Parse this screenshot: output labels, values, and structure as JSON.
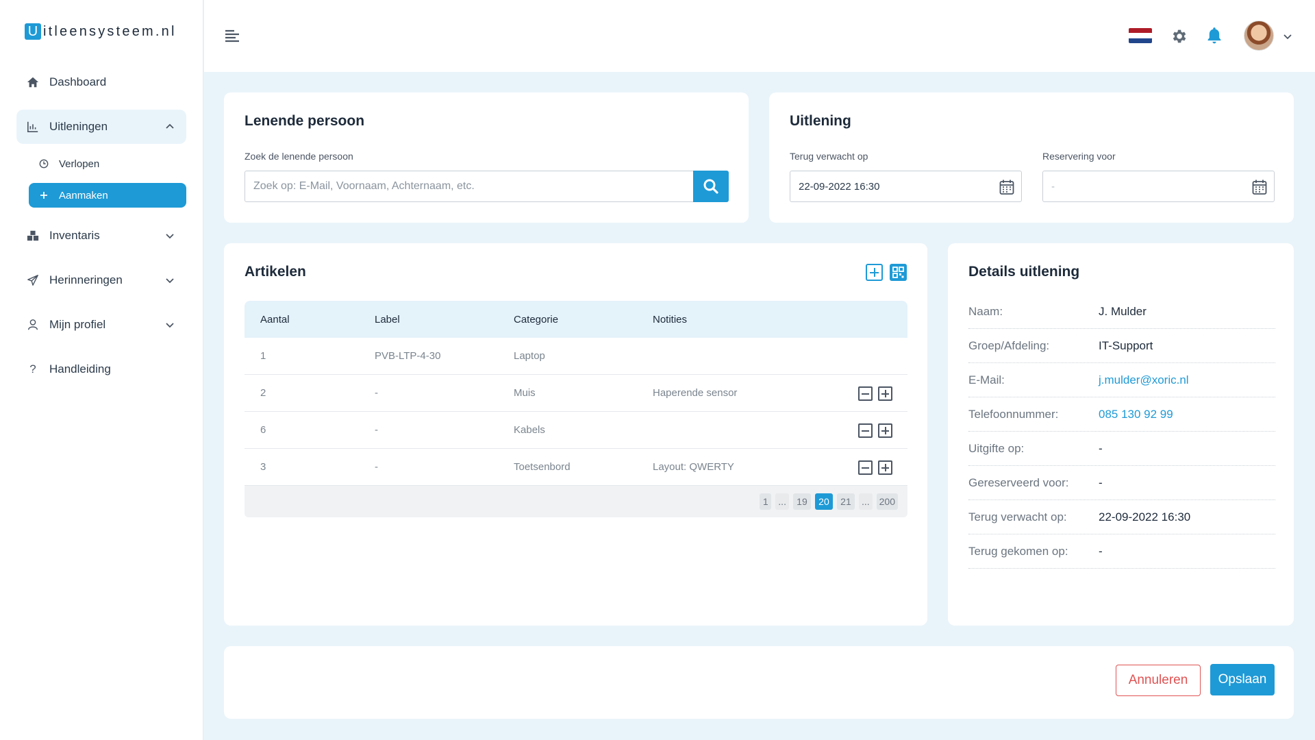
{
  "brand": {
    "initial": "U",
    "rest": "itleensysteem.nl"
  },
  "sidebar": {
    "items": [
      {
        "label": "Dashboard"
      },
      {
        "label": "Uitleningen"
      },
      {
        "label": "Inventaris"
      },
      {
        "label": "Herinneringen"
      },
      {
        "label": "Mijn profiel"
      },
      {
        "label": "Handleiding"
      }
    ],
    "subitems": [
      {
        "label": "Verlopen"
      },
      {
        "label": "Aanmaken"
      }
    ]
  },
  "borrower": {
    "title": "Lenende persoon",
    "search_label": "Zoek de lenende persoon",
    "search_placeholder": "Zoek op: E-Mail, Voornaam, Achternaam, etc."
  },
  "loan": {
    "title": "Uitlening",
    "return_label": "Terug verwacht op",
    "return_value": "22-09-2022 16:30",
    "reservation_label": "Reservering voor",
    "reservation_value": "-"
  },
  "articles": {
    "title": "Artikelen",
    "columns": [
      "Aantal",
      "Label",
      "Categorie",
      "Notities"
    ],
    "rows": [
      {
        "aantal": "1",
        "label": "PVB-LTP-4-30",
        "categorie": "Laptop",
        "notities": ""
      },
      {
        "aantal": "2",
        "label": "-",
        "categorie": "Muis",
        "notities": "Haperende sensor"
      },
      {
        "aantal": "6",
        "label": "-",
        "categorie": "Kabels",
        "notities": ""
      },
      {
        "aantal": "3",
        "label": "-",
        "categorie": "Toetsenbord",
        "notities": "Layout: QWERTY"
      }
    ],
    "pagination": [
      "1",
      "...",
      "19",
      "20",
      "21",
      "...",
      "200"
    ],
    "current_page": "20"
  },
  "details": {
    "title": "Details uitlening",
    "rows": [
      {
        "label": "Naam:",
        "value": "J. Mulder"
      },
      {
        "label": "Groep/Afdeling:",
        "value": "IT-Support"
      },
      {
        "label": "E-Mail:",
        "value": "j.mulder@xoric.nl"
      },
      {
        "label": "Telefoonnummer:",
        "value": "085 130 92 99"
      },
      {
        "label": "Uitgifte op:",
        "value": "-"
      },
      {
        "label": "Gereserveerd voor:",
        "value": "-"
      },
      {
        "label": "Terug verwacht op:",
        "value": "22-09-2022 16:30"
      },
      {
        "label": "Terug gekomen op:",
        "value": "-"
      }
    ]
  },
  "actions": {
    "cancel": "Annuleren",
    "save": "Opslaan"
  },
  "colors": {
    "accent": "#1e9ad6",
    "danger": "#e05252",
    "background": "#e9f4fa"
  }
}
